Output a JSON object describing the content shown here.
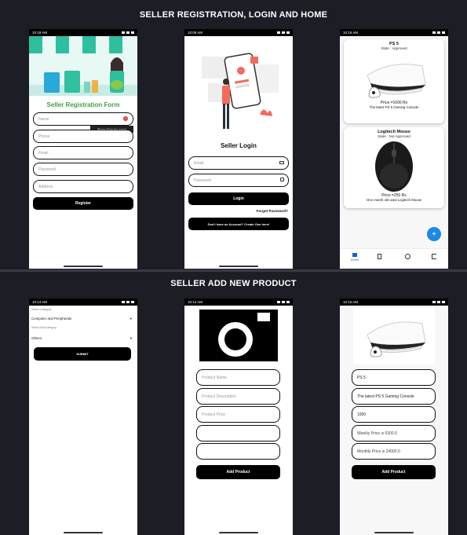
{
  "sections": {
    "top_title": "SELLER REGISTRATION, LOGIN AND HOME",
    "bottom_title": "SELLER ADD NEW PRODUCT"
  },
  "status": {
    "t1": "10:19 AM",
    "t2": "10:09 AM",
    "t3": "10:19 AM",
    "t4": "10:14 AM",
    "t5": "10:14 AM",
    "t6": "10:15 AM"
  },
  "registration": {
    "title": "Seller Registration Form",
    "name_placeholder": "Name",
    "error_tooltip": "Please Enter the name!",
    "phone_placeholder": "Phone",
    "email_placeholder": "Email",
    "password_placeholder": "Password",
    "address_placeholder": "Address",
    "register_label": "Register"
  },
  "login": {
    "title": "Seller Login",
    "email_placeholder": "Email",
    "password_placeholder": "Password",
    "login_label": "Login",
    "forgot_label": "Forgot Password?",
    "create_label": "Don't have an Account? Create One here!"
  },
  "home": {
    "products": [
      {
        "name": "PS 5",
        "state": "State : Approved",
        "price": "Price =1000 Rs",
        "desc": "The latest PS 5 Gaming Console"
      },
      {
        "name": "Logitech Mouse",
        "state": "State : Not Approved",
        "price": "Price =250 Rs",
        "desc": "One month old used Logitech Mouse"
      }
    ],
    "fab": "+",
    "nav_home": "Home"
  },
  "category": {
    "category_label": "Select Category",
    "category_value": "Computer and Peripherals",
    "subcategory_label": "Select SubCategory",
    "subcategory_value": "Others",
    "submit_label": "SUBMIT"
  },
  "add_product": {
    "name_placeholder": "Product Name",
    "desc_placeholder": "Product Description",
    "price_placeholder": "Product Price",
    "add_label": "Add Product"
  },
  "filled_product": {
    "name": "PS 5",
    "desc": "The latest PS 5 Gaming Console",
    "price": "1000",
    "weekly": "Weekly Price is 6300.0",
    "monthly": "Monthly Price is 24000.0",
    "add_label": "Add Product"
  }
}
